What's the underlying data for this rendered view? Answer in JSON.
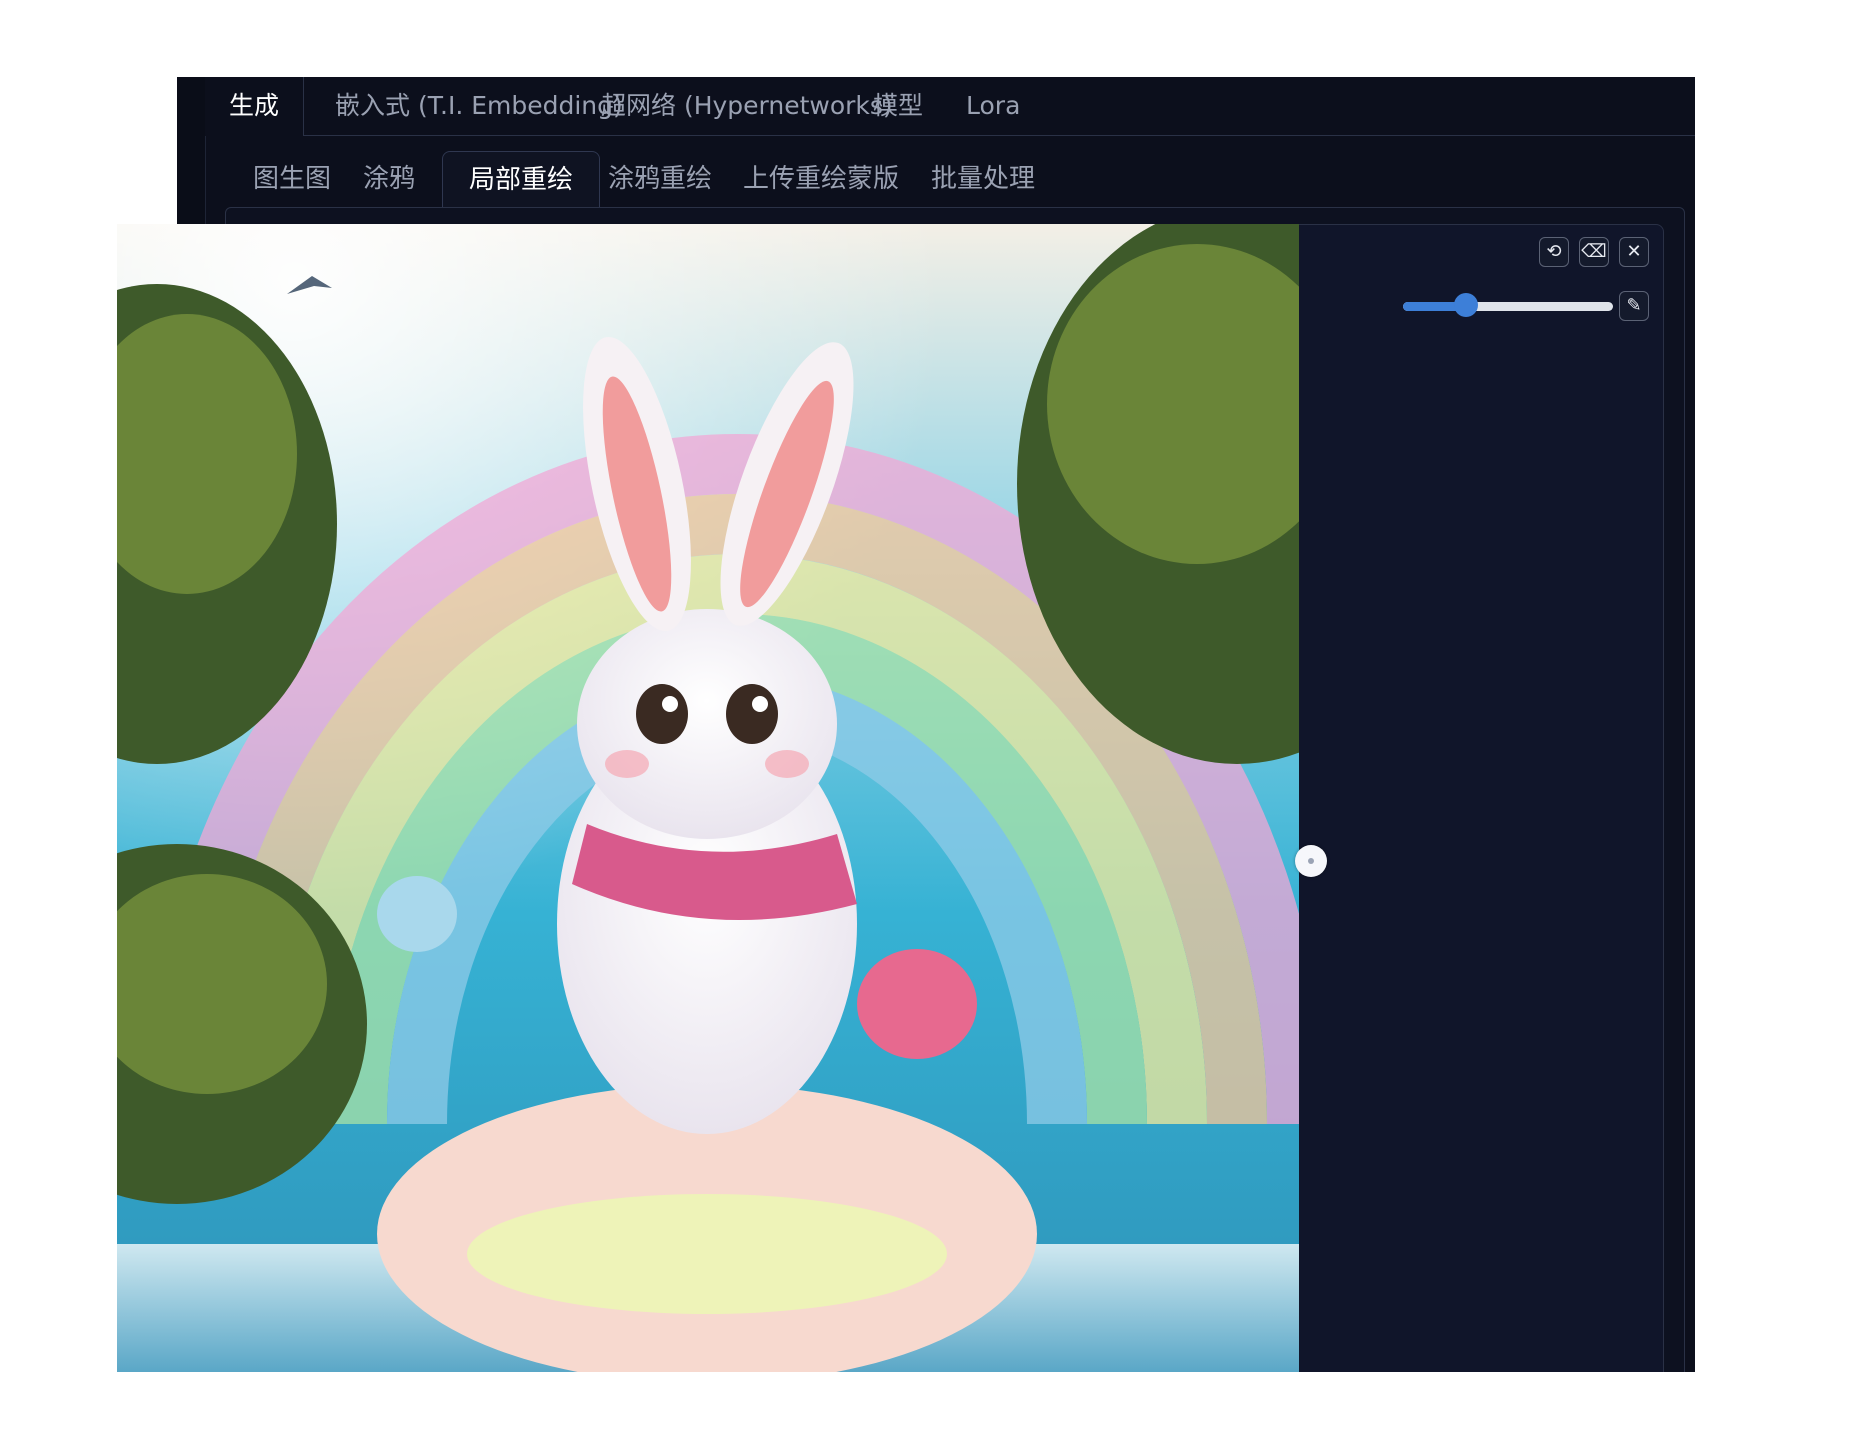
{
  "main_tabs": [
    "生成",
    "嵌入式 (T.I. Embedding)",
    "超网络 (Hypernetworks)",
    "模型",
    "Lora"
  ],
  "sub_tabs": [
    "图生图",
    "涂鸦",
    "局部重绘",
    "涂鸦重绘",
    "上传重绘蒙版",
    "批量处理"
  ],
  "active_main_tab": "生成",
  "active_sub_tab": "局部重绘",
  "info_icon": "i",
  "toolbar": {
    "undo_icon": "undo-icon",
    "eraser_icon": "eraser-icon",
    "close_icon": "close-icon",
    "brush_icon": "brush-icon"
  },
  "brush_size_fraction": 0.3,
  "colors": {
    "background": "#0c0f1c",
    "slider_fill": "#3d7fd8",
    "slider_track": "#dfe3ea"
  }
}
